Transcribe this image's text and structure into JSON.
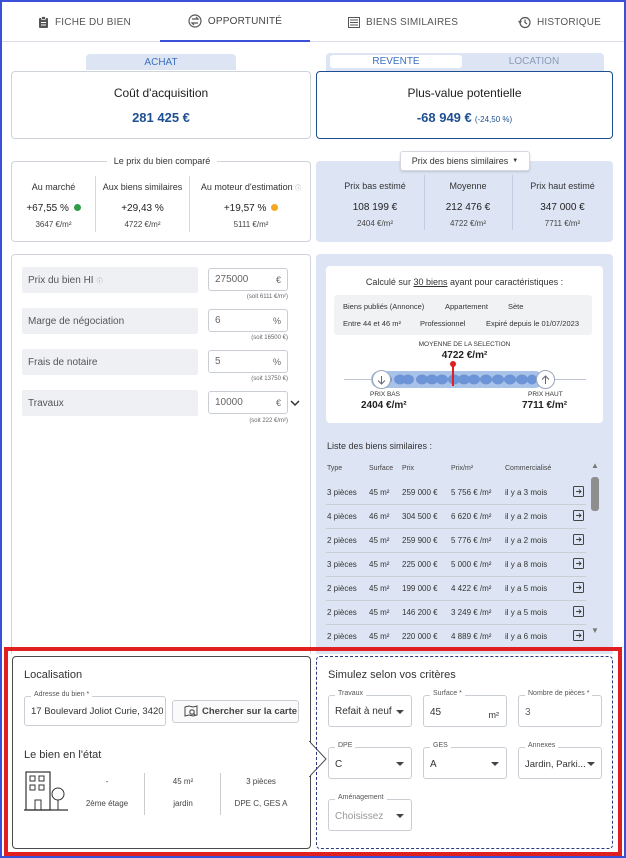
{
  "tabs": [
    {
      "label": "FICHE DU BIEN",
      "icon": "clipboard-icon"
    },
    {
      "label": "OPPORTUNITÉ",
      "icon": "exchange-icon"
    },
    {
      "label": "BIENS SIMILAIRES",
      "icon": "list-icon"
    },
    {
      "label": "HISTORIQUE",
      "icon": "history-icon"
    }
  ],
  "left_toggle": {
    "label": "ACHAT"
  },
  "right_toggle": {
    "revente": "REVENTE",
    "location": "LOCATION"
  },
  "acquisition": {
    "title": "Coût d'acquisition",
    "value": "281 425 €"
  },
  "plusvalue": {
    "title": "Plus-value potentielle",
    "value": "-68 949 €",
    "pct": "(-24,50 %)"
  },
  "compare": {
    "title": "Le prix du bien comparé",
    "cols": [
      {
        "label": "Au marché",
        "value": "+67,55 %",
        "sub": "3647 €/m²",
        "dot": "#2e9e48"
      },
      {
        "label": "Aux biens similaires",
        "value": "+29,43 %",
        "sub": "4722 €/m²",
        "dot": ""
      },
      {
        "label": "Au moteur d'estimation",
        "value": "+19,57 %",
        "sub": "5111 €/m²",
        "dot": "#f5a623"
      }
    ]
  },
  "similar_prices": {
    "dropdown": "Prix des biens similaires",
    "cols": [
      {
        "label": "Prix bas estimé",
        "value": "108 199 €",
        "sub": "2404 €/m²"
      },
      {
        "label": "Moyenne",
        "value": "212 476 €",
        "sub": "4722 €/m²"
      },
      {
        "label": "Prix haut estimé",
        "value": "347 000 €",
        "sub": "7711 €/m²"
      }
    ]
  },
  "form": {
    "prix": {
      "label": "Prix du bien HI",
      "value": "275000",
      "unit": "€",
      "sub": "(soit 6111 €/m²)"
    },
    "marge": {
      "label": "Marge de négociation",
      "value": "6",
      "unit": "%",
      "sub": "(soit 16500 €)"
    },
    "frais": {
      "label": "Frais de notaire",
      "value": "5",
      "unit": "%",
      "sub": "(soit 13750 €)"
    },
    "travaux": {
      "label": "Travaux",
      "value": "10000",
      "unit": "€",
      "sub": "(soit 222 €/m²)"
    }
  },
  "calc": {
    "intro_prefix": "Calculé sur",
    "intro_link": "30 biens",
    "intro_suffix": "ayant pour caractéristiques :",
    "tags_row1": [
      "Biens publiés (Annonce)",
      "Appartement",
      "Sète"
    ],
    "tags_row2": [
      "Entre 44 et 46 m²",
      "Professionnel",
      "Expiré depuis le 01/07/2023"
    ],
    "mean_label": "MOYENNE DE LA SELECTION",
    "mean_value": "4722 €/m²",
    "low_label": "PRIX BAS",
    "low_value": "2404 €/m²",
    "high_label": "PRIX HAUT",
    "high_value": "7711 €/m²"
  },
  "list": {
    "title": "Liste des biens similaires :",
    "headers": [
      "Type",
      "Surface",
      "Prix",
      "Prix/m²",
      "Commercialisé"
    ],
    "rows": [
      [
        "3 pièces",
        "45 m²",
        "259 000 €",
        "5 756 € /m²",
        "il y a 3 mois"
      ],
      [
        "4 pièces",
        "46 m²",
        "304 500 €",
        "6 620 € /m²",
        "il y a 2 mois"
      ],
      [
        "2 pièces",
        "45 m²",
        "259 900 €",
        "5 776 € /m²",
        "il y a 2 mois"
      ],
      [
        "3 pièces",
        "45 m²",
        "225 000 €",
        "5 000 € /m²",
        "il y a 8 mois"
      ],
      [
        "2 pièces",
        "45 m²",
        "199 000 €",
        "4 422 € /m²",
        "il y a 5 mois"
      ],
      [
        "2 pièces",
        "45 m²",
        "146 200 €",
        "3 249 € /m²",
        "il y a 5 mois"
      ],
      [
        "2 pièces",
        "45 m²",
        "220 000 €",
        "4 889 € /m²",
        "il y a 6 mois"
      ]
    ]
  },
  "localisation": {
    "title": "Localisation",
    "address_legend": "Adresse du bien *",
    "address_value": "17 Boulevard Joliot Curie, 3420",
    "map_button": "Chercher sur la carte",
    "etat_title": "Le bien en l'état",
    "etat_cols": [
      {
        "top": "-",
        "bottom": "2ème étage"
      },
      {
        "top": "45 m²",
        "bottom": "jardin"
      },
      {
        "top": "3 pièces",
        "bottom": "DPE C, GES A"
      }
    ]
  },
  "simulez": {
    "title": "Simulez selon vos critères",
    "travaux": {
      "legend": "Travaux",
      "value": "Refait à neuf"
    },
    "surface": {
      "legend": "Surface *",
      "value": "45",
      "unit": "m²"
    },
    "pieces": {
      "legend": "Nombre de pièces *",
      "value": "3"
    },
    "dpe": {
      "legend": "DPE",
      "value": "C"
    },
    "ges": {
      "legend": "GES",
      "value": "A"
    },
    "annexes": {
      "legend": "Annexes",
      "value": "Jardin, Parki..."
    },
    "amenagement": {
      "legend": "Aménagement",
      "value": "Choisissez"
    }
  },
  "colors": {
    "accent": "#3b4fd8",
    "brand_blue": "#1d4f91",
    "panel": "#dde5f4",
    "highlight": "#e02020"
  }
}
